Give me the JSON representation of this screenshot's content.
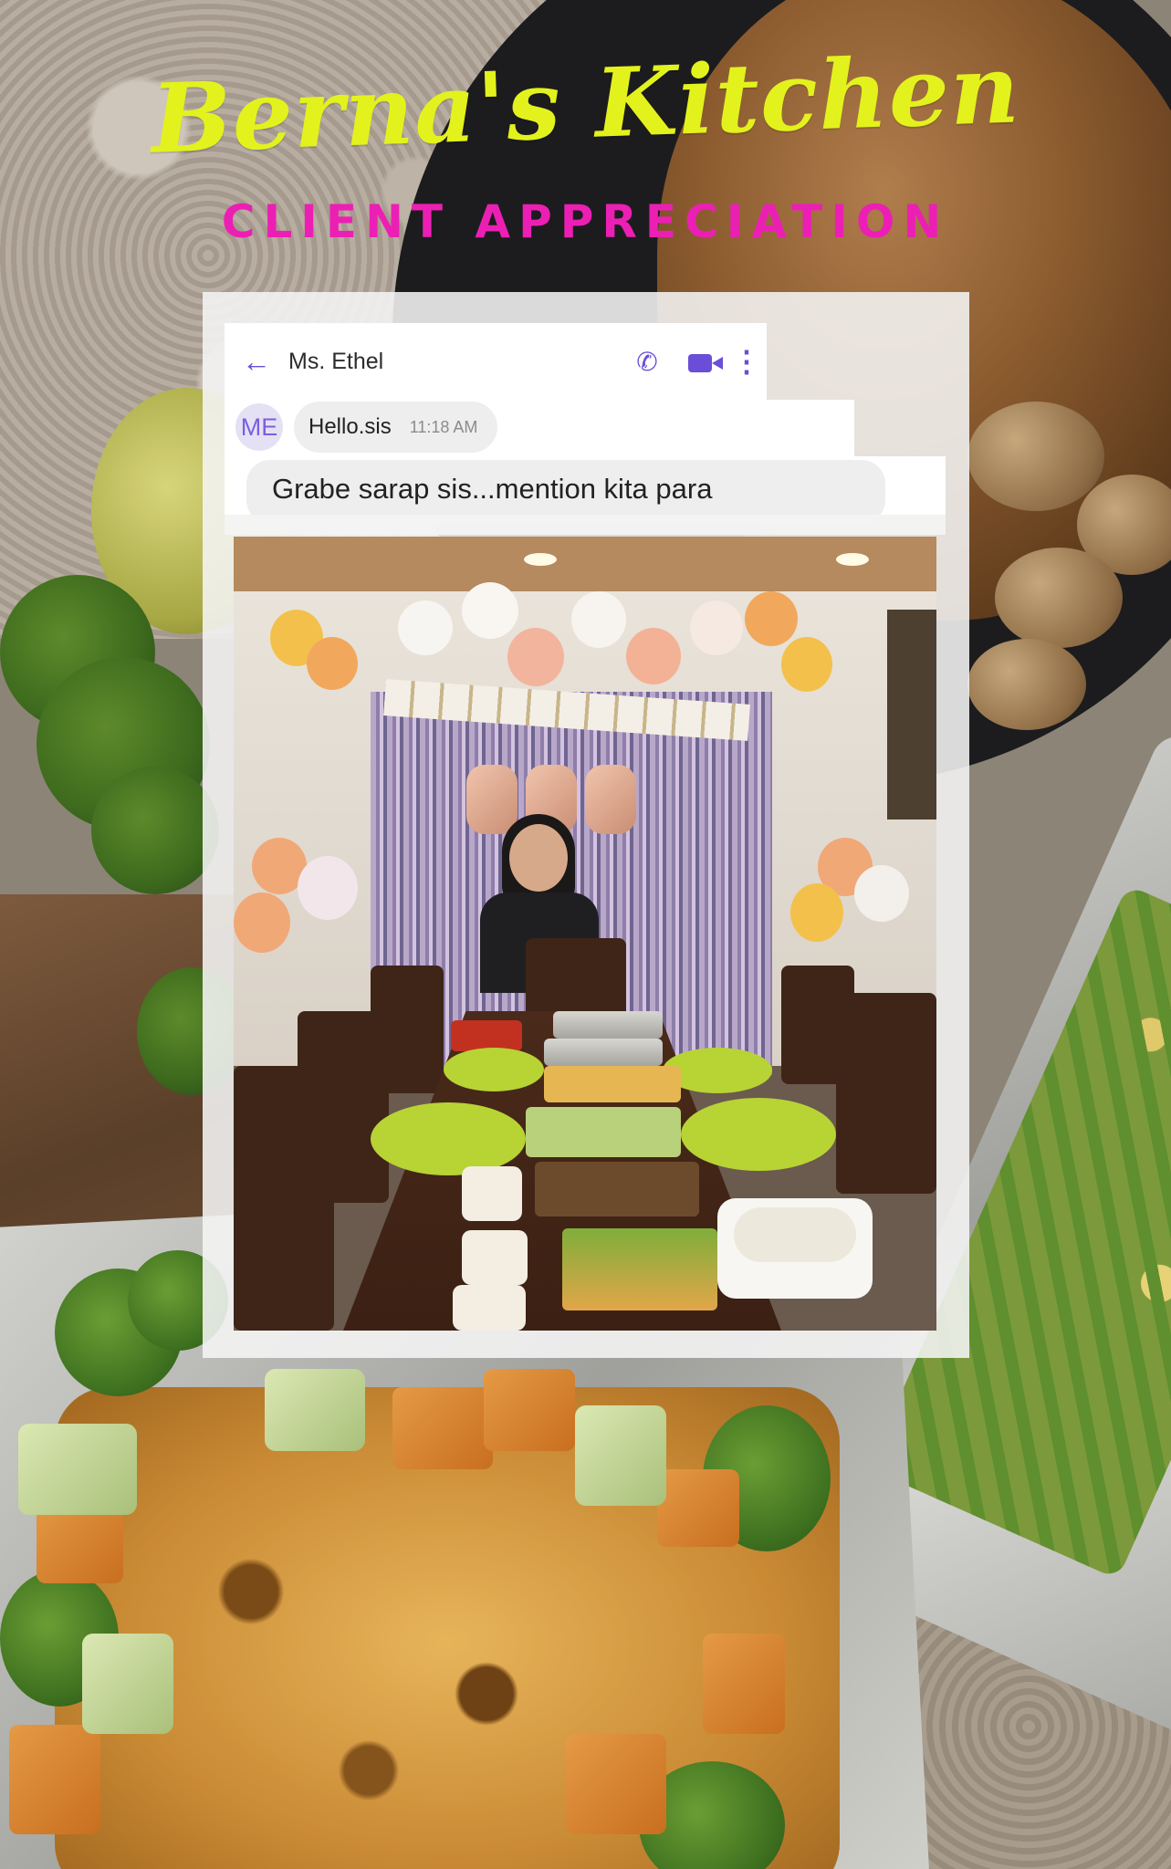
{
  "poster": {
    "title": "Berna's Kitchen",
    "subtitle": "CLIENT APPRECIATION"
  },
  "chat": {
    "contact_name": "Ms. Ethel",
    "avatar_initials": "ME",
    "icons": {
      "back": "back-arrow-icon",
      "call": "phone-icon",
      "video": "video-call-icon",
      "menu": "more-vertical-icon"
    },
    "accent_color": "#6a4ed8",
    "messages": [
      {
        "text": "Hello.sis",
        "time": "11:18 AM"
      },
      {
        "text": "Grabe sarap sis...mention kita para"
      }
    ]
  },
  "colors": {
    "title": "#e3f21d",
    "subtitle": "#ec1fb4",
    "bubble": "#eeeeee"
  }
}
